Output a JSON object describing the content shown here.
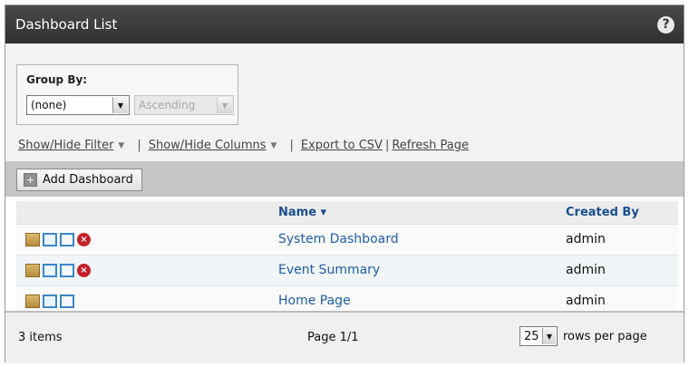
{
  "header": {
    "title": "Dashboard List",
    "help_icon": "help-icon"
  },
  "controls": {
    "group_by_label": "Group By:",
    "group_by_value": "(none)",
    "order_value": "Ascending",
    "links": {
      "show_hide_filter": "Show/Hide Filter",
      "show_hide_columns": "Show/Hide Columns",
      "export_csv": "Export to CSV",
      "refresh_page": "Refresh Page"
    }
  },
  "toolbar": {
    "add_label": "Add Dashboard"
  },
  "table": {
    "columns": {
      "name": "Name ▾",
      "created_by": "Created By"
    },
    "rows": [
      {
        "name": "System Dashboard",
        "created_by": "admin",
        "actions": [
          "edit-icon",
          "duplicate-icon",
          "share-icon",
          "delete-icon"
        ]
      },
      {
        "name": "Event Summary",
        "created_by": "admin",
        "actions": [
          "edit-icon",
          "duplicate-icon",
          "share-icon",
          "delete-icon"
        ]
      },
      {
        "name": "Home Page",
        "created_by": "admin",
        "actions": [
          "edit-icon",
          "duplicate-icon",
          "share-icon"
        ]
      }
    ]
  },
  "footer": {
    "count": "3 items",
    "page": "Page 1/1",
    "rows_per_page_value": "25",
    "rows_per_page_label": "rows per page"
  }
}
